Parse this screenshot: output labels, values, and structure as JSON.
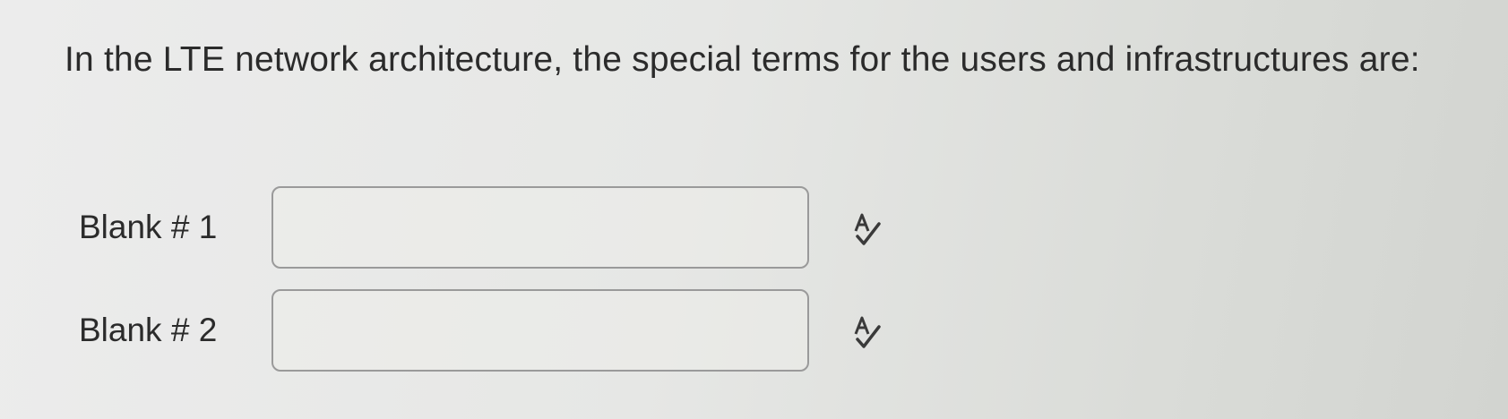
{
  "question": {
    "text": "In the LTE network architecture, the special terms for the users and infrastructures are:"
  },
  "blanks": [
    {
      "label": "Blank # 1",
      "value": "",
      "icon": "spellcheck-icon"
    },
    {
      "label": "Blank # 2",
      "value": "",
      "icon": "spellcheck-icon"
    }
  ]
}
